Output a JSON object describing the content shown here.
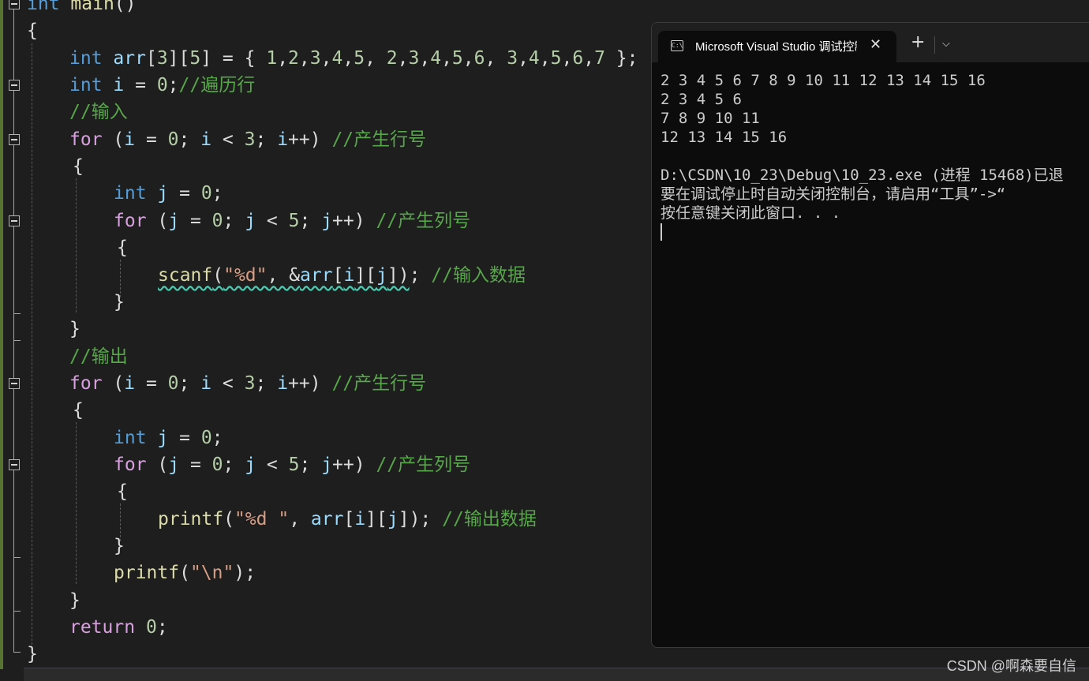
{
  "editor": {
    "lines": [
      [
        {
          "t": "int",
          "c": "kw"
        },
        {
          "t": " "
        },
        {
          "t": "main",
          "c": "fn"
        },
        {
          "t": "()",
          "c": "pun"
        }
      ],
      [
        {
          "t": "{",
          "c": "pun"
        }
      ],
      [
        {
          "t": "int",
          "c": "kw"
        },
        {
          "t": " "
        },
        {
          "t": "arr",
          "c": "var"
        },
        {
          "t": "[",
          "c": "pun"
        },
        {
          "t": "3",
          "c": "num"
        },
        {
          "t": "][",
          "c": "pun"
        },
        {
          "t": "5",
          "c": "num"
        },
        {
          "t": "] = { ",
          "c": "pun"
        },
        {
          "t": "1",
          "c": "num"
        },
        {
          "t": ",",
          "c": "pun"
        },
        {
          "t": "2",
          "c": "num"
        },
        {
          "t": ",",
          "c": "pun"
        },
        {
          "t": "3",
          "c": "num"
        },
        {
          "t": ",",
          "c": "pun"
        },
        {
          "t": "4",
          "c": "num"
        },
        {
          "t": ",",
          "c": "pun"
        },
        {
          "t": "5",
          "c": "num"
        },
        {
          "t": ", ",
          "c": "pun"
        },
        {
          "t": "2",
          "c": "num"
        },
        {
          "t": ",",
          "c": "pun"
        },
        {
          "t": "3",
          "c": "num"
        },
        {
          "t": ",",
          "c": "pun"
        },
        {
          "t": "4",
          "c": "num"
        },
        {
          "t": ",",
          "c": "pun"
        },
        {
          "t": "5",
          "c": "num"
        },
        {
          "t": ",",
          "c": "pun"
        },
        {
          "t": "6",
          "c": "num"
        },
        {
          "t": ", ",
          "c": "pun"
        },
        {
          "t": "3",
          "c": "num"
        },
        {
          "t": ",",
          "c": "pun"
        },
        {
          "t": "4",
          "c": "num"
        },
        {
          "t": ",",
          "c": "pun"
        },
        {
          "t": "5",
          "c": "num"
        },
        {
          "t": ",",
          "c": "pun"
        },
        {
          "t": "6",
          "c": "num"
        },
        {
          "t": ",",
          "c": "pun"
        },
        {
          "t": "7",
          "c": "num"
        },
        {
          "t": " };",
          "c": "pun"
        }
      ],
      [
        {
          "t": "int",
          "c": "kw"
        },
        {
          "t": " "
        },
        {
          "t": "i",
          "c": "var"
        },
        {
          "t": " = ",
          "c": "pun"
        },
        {
          "t": "0",
          "c": "num"
        },
        {
          "t": ";",
          "c": "pun"
        },
        {
          "t": "//遍历行",
          "c": "cmt"
        }
      ],
      [
        {
          "t": "//输入",
          "c": "cmt"
        }
      ],
      [
        {
          "t": "for",
          "c": "kw2"
        },
        {
          "t": " (",
          "c": "pun"
        },
        {
          "t": "i",
          "c": "var"
        },
        {
          "t": " = ",
          "c": "pun"
        },
        {
          "t": "0",
          "c": "num"
        },
        {
          "t": "; ",
          "c": "pun"
        },
        {
          "t": "i",
          "c": "var"
        },
        {
          "t": " < ",
          "c": "pun"
        },
        {
          "t": "3",
          "c": "num"
        },
        {
          "t": "; ",
          "c": "pun"
        },
        {
          "t": "i",
          "c": "var"
        },
        {
          "t": "++) ",
          "c": "pun"
        },
        {
          "t": "//产生行号",
          "c": "cmt"
        }
      ],
      [
        {
          "t": "{",
          "c": "pun"
        }
      ],
      [
        {
          "t": "int",
          "c": "kw"
        },
        {
          "t": " "
        },
        {
          "t": "j",
          "c": "var"
        },
        {
          "t": " = ",
          "c": "pun"
        },
        {
          "t": "0",
          "c": "num"
        },
        {
          "t": ";",
          "c": "pun"
        }
      ],
      [
        {
          "t": "for",
          "c": "kw2"
        },
        {
          "t": " (",
          "c": "pun"
        },
        {
          "t": "j",
          "c": "var"
        },
        {
          "t": " = ",
          "c": "pun"
        },
        {
          "t": "0",
          "c": "num"
        },
        {
          "t": "; ",
          "c": "pun"
        },
        {
          "t": "j",
          "c": "var"
        },
        {
          "t": " < ",
          "c": "pun"
        },
        {
          "t": "5",
          "c": "num"
        },
        {
          "t": "; ",
          "c": "pun"
        },
        {
          "t": "j",
          "c": "var"
        },
        {
          "t": "++) ",
          "c": "pun"
        },
        {
          "t": "//产生列号",
          "c": "cmt"
        }
      ],
      [
        {
          "t": "{",
          "c": "pun"
        }
      ],
      [
        {
          "t": "scanf",
          "c": "fn",
          "u": 1
        },
        {
          "t": "(",
          "c": "pun",
          "u": 1
        },
        {
          "t": "\"%d\"",
          "c": "str",
          "u": 1
        },
        {
          "t": ", &",
          "c": "pun",
          "u": 1
        },
        {
          "t": "arr",
          "c": "var",
          "u": 1
        },
        {
          "t": "[",
          "c": "pun",
          "u": 1
        },
        {
          "t": "i",
          "c": "var",
          "u": 1
        },
        {
          "t": "][",
          "c": "pun",
          "u": 1
        },
        {
          "t": "j",
          "c": "var",
          "u": 1
        },
        {
          "t": "])",
          "c": "pun",
          "u": 1
        },
        {
          "t": "; ",
          "c": "pun"
        },
        {
          "t": "//输入数据",
          "c": "cmt"
        }
      ],
      [
        {
          "t": "}",
          "c": "pun"
        }
      ],
      [
        {
          "t": "}",
          "c": "pun"
        }
      ],
      [
        {
          "t": "//输出",
          "c": "cmt"
        }
      ],
      [
        {
          "t": "for",
          "c": "kw2"
        },
        {
          "t": " (",
          "c": "pun"
        },
        {
          "t": "i",
          "c": "var"
        },
        {
          "t": " = ",
          "c": "pun"
        },
        {
          "t": "0",
          "c": "num"
        },
        {
          "t": "; ",
          "c": "pun"
        },
        {
          "t": "i",
          "c": "var"
        },
        {
          "t": " < ",
          "c": "pun"
        },
        {
          "t": "3",
          "c": "num"
        },
        {
          "t": "; ",
          "c": "pun"
        },
        {
          "t": "i",
          "c": "var"
        },
        {
          "t": "++) ",
          "c": "pun"
        },
        {
          "t": "//产生行号",
          "c": "cmt"
        }
      ],
      [
        {
          "t": "{",
          "c": "pun"
        }
      ],
      [
        {
          "t": "int",
          "c": "kw"
        },
        {
          "t": " "
        },
        {
          "t": "j",
          "c": "var"
        },
        {
          "t": " = ",
          "c": "pun"
        },
        {
          "t": "0",
          "c": "num"
        },
        {
          "t": ";",
          "c": "pun"
        }
      ],
      [
        {
          "t": "for",
          "c": "kw2"
        },
        {
          "t": " (",
          "c": "pun"
        },
        {
          "t": "j",
          "c": "var"
        },
        {
          "t": " = ",
          "c": "pun"
        },
        {
          "t": "0",
          "c": "num"
        },
        {
          "t": "; ",
          "c": "pun"
        },
        {
          "t": "j",
          "c": "var"
        },
        {
          "t": " < ",
          "c": "pun"
        },
        {
          "t": "5",
          "c": "num"
        },
        {
          "t": "; ",
          "c": "pun"
        },
        {
          "t": "j",
          "c": "var"
        },
        {
          "t": "++) ",
          "c": "pun"
        },
        {
          "t": "//产生列号",
          "c": "cmt"
        }
      ],
      [
        {
          "t": "{",
          "c": "pun"
        }
      ],
      [
        {
          "t": "printf",
          "c": "fn"
        },
        {
          "t": "(",
          "c": "pun"
        },
        {
          "t": "\"%d \"",
          "c": "str"
        },
        {
          "t": ", ",
          "c": "pun"
        },
        {
          "t": "arr",
          "c": "var"
        },
        {
          "t": "[",
          "c": "pun"
        },
        {
          "t": "i",
          "c": "var"
        },
        {
          "t": "][",
          "c": "pun"
        },
        {
          "t": "j",
          "c": "var"
        },
        {
          "t": "]); ",
          "c": "pun"
        },
        {
          "t": "//输出数据",
          "c": "cmt"
        }
      ],
      [
        {
          "t": "}",
          "c": "pun"
        }
      ],
      [
        {
          "t": "printf",
          "c": "fn"
        },
        {
          "t": "(",
          "c": "pun"
        },
        {
          "t": "\"\\n\"",
          "c": "str"
        },
        {
          "t": ");",
          "c": "pun"
        }
      ],
      [
        {
          "t": "}",
          "c": "pun"
        }
      ],
      [
        {
          "t": "return",
          "c": "kw2"
        },
        {
          "t": " "
        },
        {
          "t": "0",
          "c": "num"
        },
        {
          "t": ";",
          "c": "pun"
        }
      ],
      [
        {
          "t": "}",
          "c": "pun"
        }
      ]
    ]
  },
  "console": {
    "tab_title": "Microsoft Visual Studio 调试控制台",
    "tab_icon_text": "C:\\",
    "close_symbol": "✕",
    "new_tab_symbol": "+",
    "dropdown_symbol": "⌵",
    "output": [
      "2 3 4 5 6 7 8 9 10 11 12 13 14 15 16",
      "2 3 4 5 6",
      "7 8 9 10 11",
      "12 13 14 15 16",
      "",
      "D:\\CSDN\\10_23\\Debug\\10_23.exe (进程 15468)已退",
      "要在调试停止时自动关闭控制台，请启用“工具”->“",
      "按任意键关闭此窗口. . ."
    ]
  },
  "watermark": "CSDN @啊森要自信",
  "colors": {
    "editor_bg": "#1e1e1e",
    "keyword": "#569cd6",
    "control_keyword": "#d8a0df",
    "variable": "#9cdcfe",
    "number": "#b5cea8",
    "string": "#d69d85",
    "comment": "#57a64a",
    "function": "#dcdcaa",
    "console_bg": "#0c0c0c"
  }
}
